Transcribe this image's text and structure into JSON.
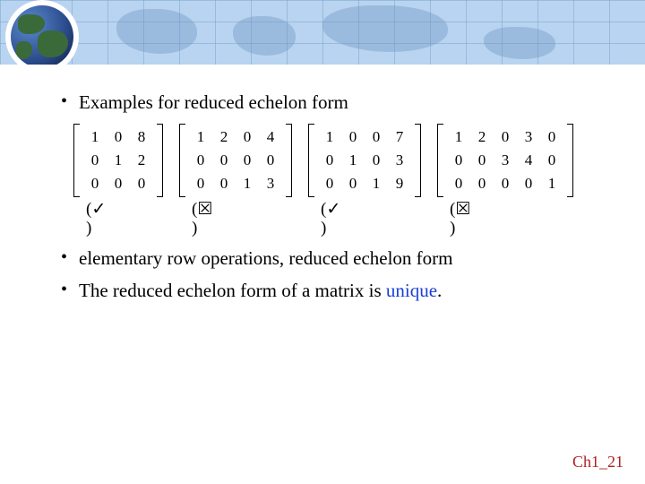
{
  "header": {
    "alt": "World map banner with globe"
  },
  "bullets": {
    "b1": "Examples for reduced echelon form",
    "b2a": "elementary row operations,",
    "b2b": "reduced echelon form",
    "b3a": "The reduced echelon form of a matrix is ",
    "b3_unique": "unique",
    "b3c": "."
  },
  "matrices": [
    {
      "cols": 3,
      "rows": [
        [
          "1",
          "0",
          "8"
        ],
        [
          "0",
          "1",
          "2"
        ],
        [
          "0",
          "0",
          "0"
        ]
      ],
      "verdict": "✓"
    },
    {
      "cols": 4,
      "rows": [
        [
          "1",
          "2",
          "0",
          "4"
        ],
        [
          "0",
          "0",
          "0",
          "0"
        ],
        [
          "0",
          "0",
          "1",
          "3"
        ]
      ],
      "verdict": "☒"
    },
    {
      "cols": 4,
      "rows": [
        [
          "1",
          "0",
          "0",
          "7"
        ],
        [
          "0",
          "1",
          "0",
          "3"
        ],
        [
          "0",
          "0",
          "1",
          "9"
        ]
      ],
      "verdict": "✓"
    },
    {
      "cols": 5,
      "rows": [
        [
          "1",
          "2",
          "0",
          "3",
          "0"
        ],
        [
          "0",
          "0",
          "3",
          "4",
          "0"
        ],
        [
          "0",
          "0",
          "0",
          "0",
          "1"
        ]
      ],
      "verdict": "☒"
    }
  ],
  "footer": "Ch1_21"
}
